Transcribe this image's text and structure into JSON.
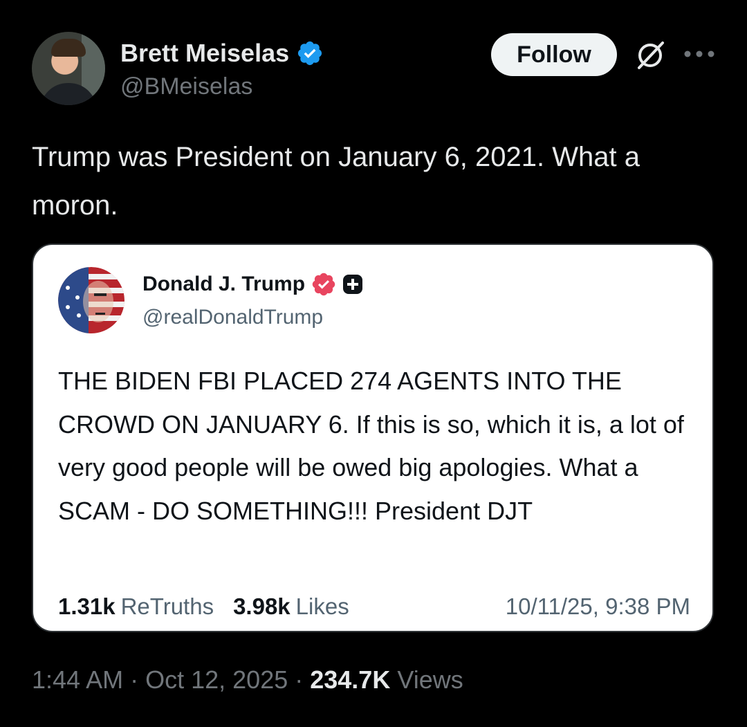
{
  "author": {
    "name": "Brett Meiselas",
    "handle": "@BMeiselas",
    "verified_color": "#1d9bf0"
  },
  "actions": {
    "follow_label": "Follow",
    "grok_icon": "grok-icon",
    "more_icon": "more-icon"
  },
  "tweet": {
    "text": "Trump was President on January 6, 2021. What a moron."
  },
  "quote": {
    "name": "Donald J. Trump",
    "handle": "@realDonaldTrump",
    "verified_color": "#e8455f",
    "text": "THE BIDEN FBI PLACED 274 AGENTS INTO THE CROWD ON JANUARY 6. If this is so, which it is, a lot of very good people will be owed big apologies. What a SCAM - DO SOMETHING!!! President DJT",
    "retruths_count": "1.31k",
    "retruths_label": "ReTruths",
    "likes_count": "3.98k",
    "likes_label": "Likes",
    "timestamp": "10/11/25, 9:38 PM"
  },
  "meta": {
    "time": "1:44 AM",
    "sep1": "·",
    "date": "Oct 12, 2025",
    "sep2": "·",
    "views_count": "234.7K",
    "views_label": "Views"
  }
}
